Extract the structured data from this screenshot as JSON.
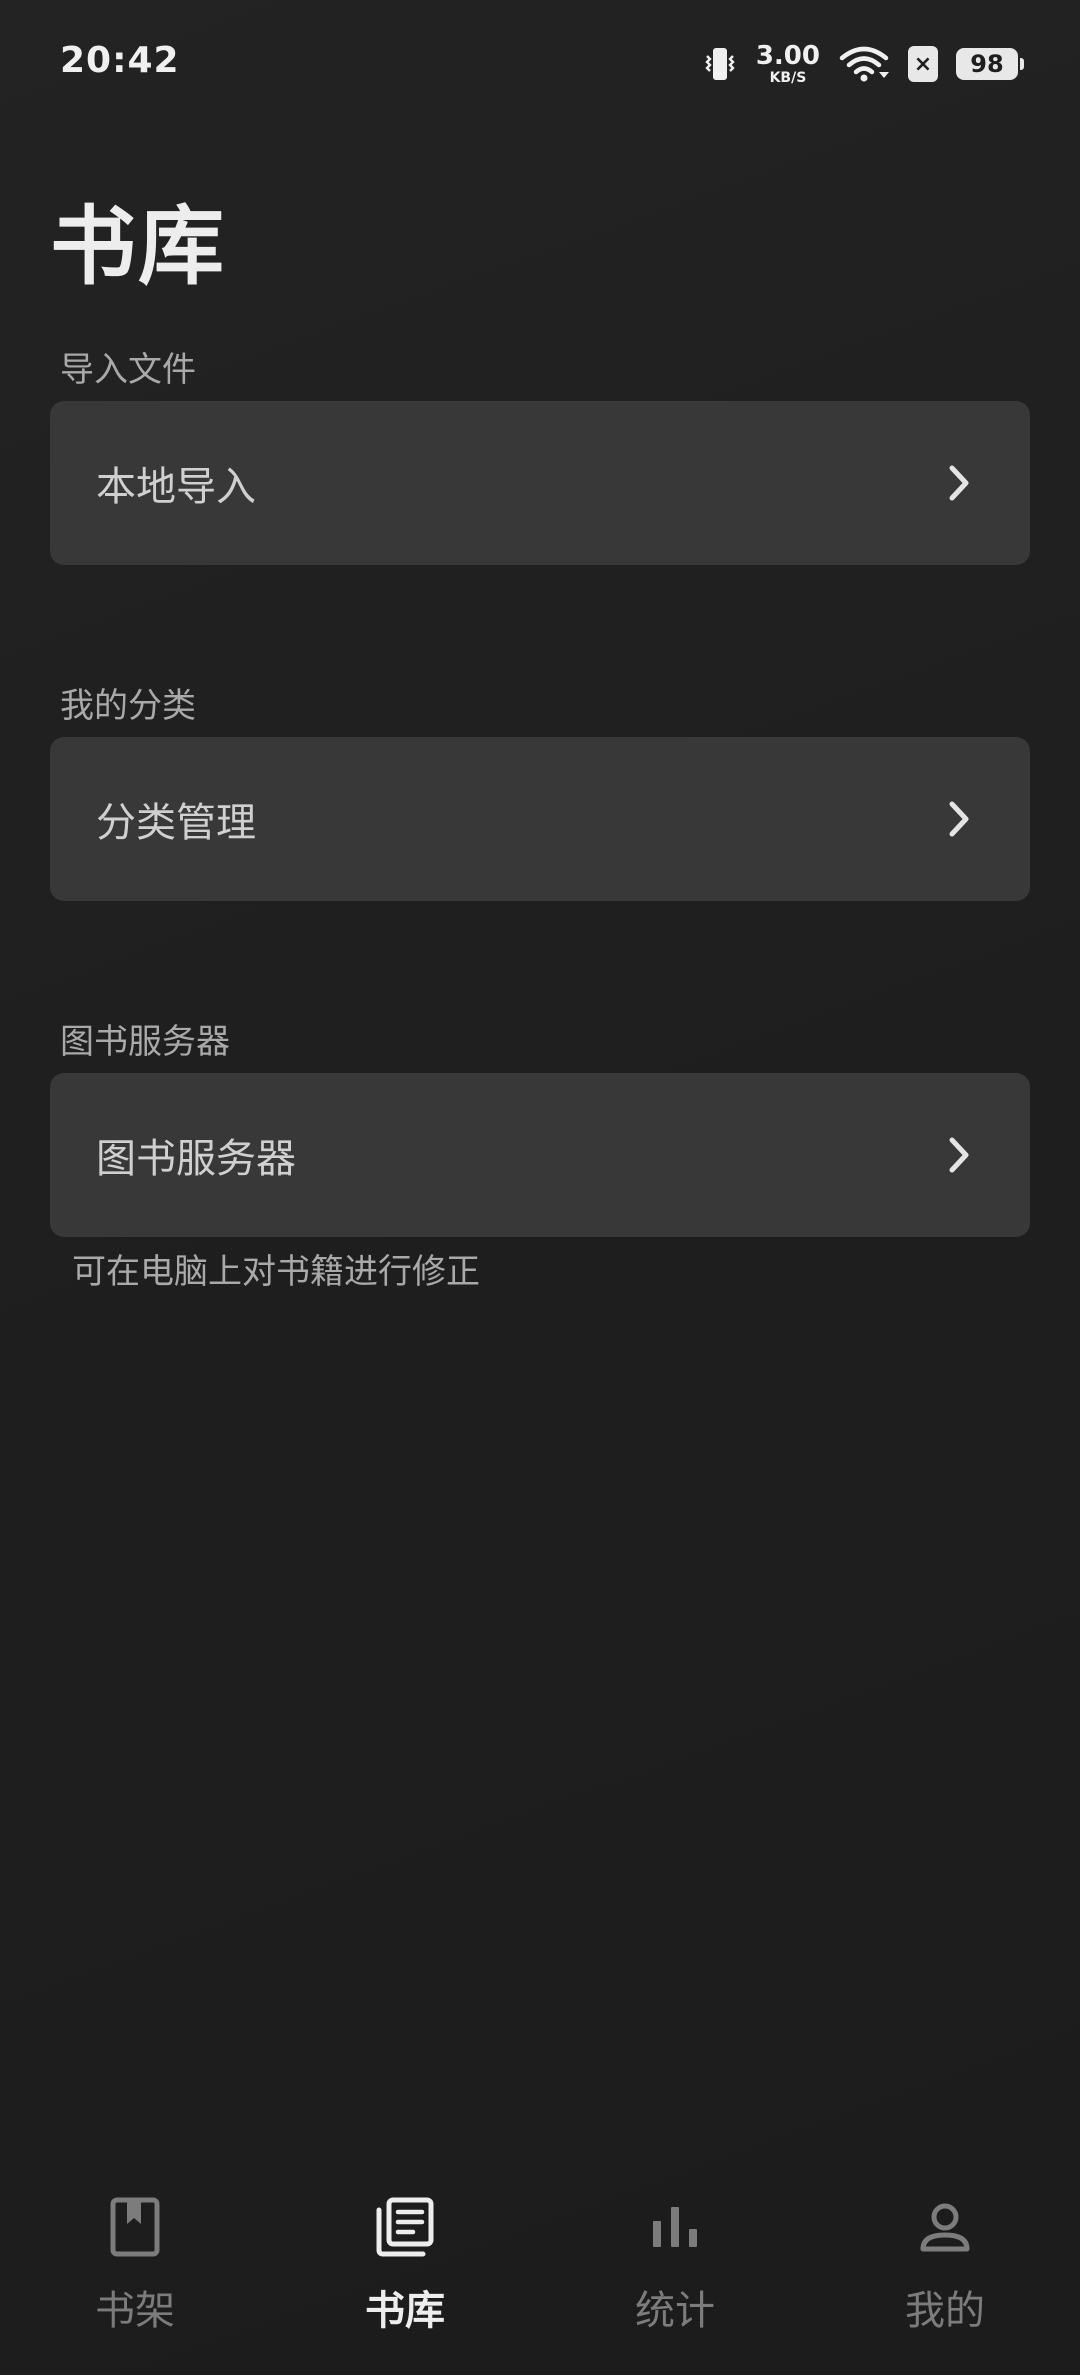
{
  "status_bar": {
    "time": "20:42",
    "net_speed_value": "3.00",
    "net_speed_unit": "KB/S",
    "battery": "98",
    "notification_glyph": "×",
    "icons": [
      "vibrate-icon",
      "net-speed",
      "wifi-icon",
      "notification-icon",
      "battery-icon"
    ]
  },
  "page": {
    "title": "书库"
  },
  "sections": [
    {
      "label": "导入文件",
      "item": "本地导入"
    },
    {
      "label": "我的分类",
      "item": "分类管理"
    },
    {
      "label": "图书服务器",
      "item": "图书服务器",
      "hint": "可在电脑上对书籍进行修正"
    }
  ],
  "bottom_nav": {
    "active": "书库",
    "items": [
      {
        "label": "书架",
        "icon": "bookshelf-icon"
      },
      {
        "label": "书库",
        "icon": "library-icon"
      },
      {
        "label": "统计",
        "icon": "bar-chart-icon"
      },
      {
        "label": "我的",
        "icon": "person-icon"
      }
    ]
  },
  "colors": {
    "background": "#1e1e1e",
    "card": "#383838",
    "text_primary": "#ededed",
    "text_secondary": "#a9a9a9",
    "nav_inactive": "#7c7c7c"
  }
}
